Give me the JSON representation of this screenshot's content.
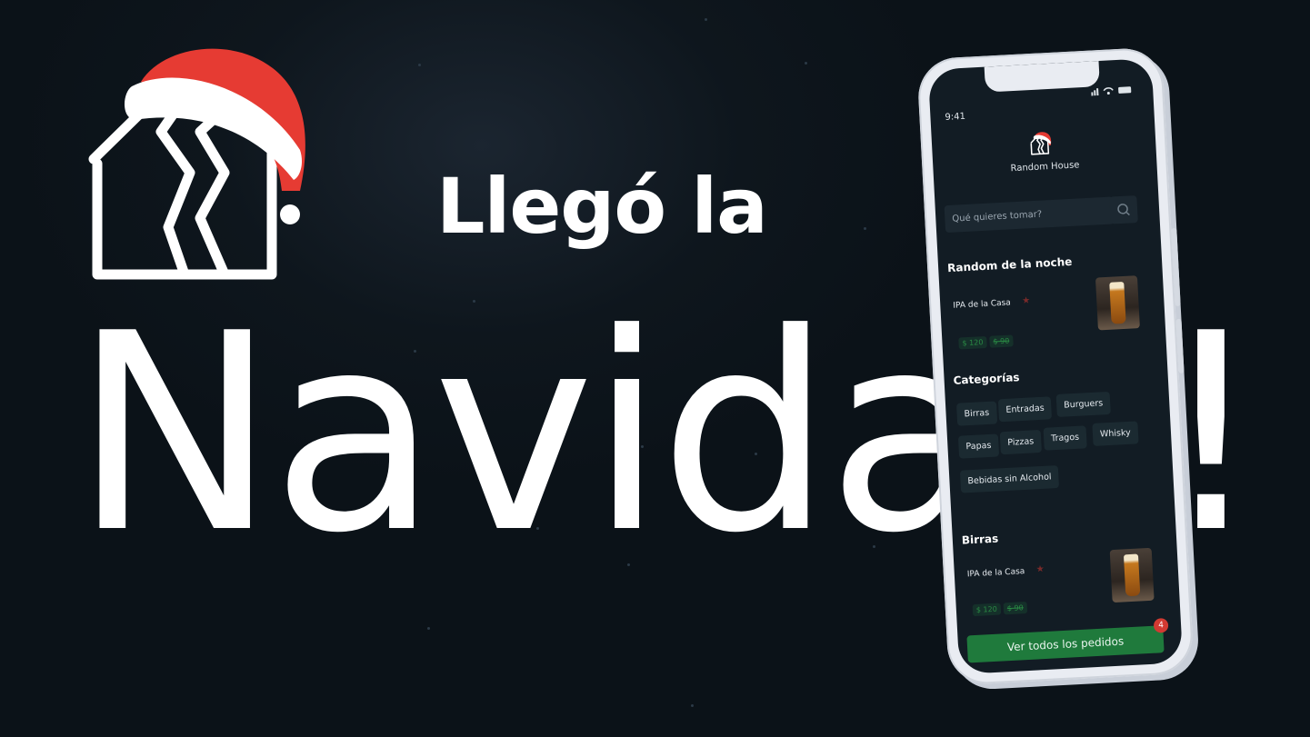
{
  "headline": {
    "line1": "Llegó la",
    "line2": "Navidad!"
  },
  "phone": {
    "status": {
      "time": "9:41"
    },
    "app": {
      "name": "Random House",
      "search_placeholder": "Qué quieres tomar?",
      "featured": {
        "title": "Random de la noche",
        "item": {
          "name": "IPA de la Casa",
          "price": "$ 120",
          "old_price": "$ 90"
        }
      },
      "categories": {
        "title": "Categorías",
        "items": [
          "Birras",
          "Entradas",
          "Burguers",
          "Papas",
          "Pizzas",
          "Tragos",
          "Whisky",
          "Bebidas sin Alcohol"
        ]
      },
      "birras": {
        "title": "Birras",
        "item": {
          "name": "IPA de la Casa",
          "price": "$ 120",
          "old_price": "$ 90"
        }
      },
      "cta": {
        "label": "Ver todos los pedidos",
        "badge": "4"
      }
    }
  },
  "colors": {
    "background": "#0e161d",
    "hat_red": "#e63b33",
    "accent_green": "#1f7a3c"
  },
  "icons": [
    "house-logo-icon",
    "santa-hat-icon",
    "search-icon",
    "star-icon",
    "signal-icon",
    "wifi-icon",
    "battery-icon"
  ]
}
